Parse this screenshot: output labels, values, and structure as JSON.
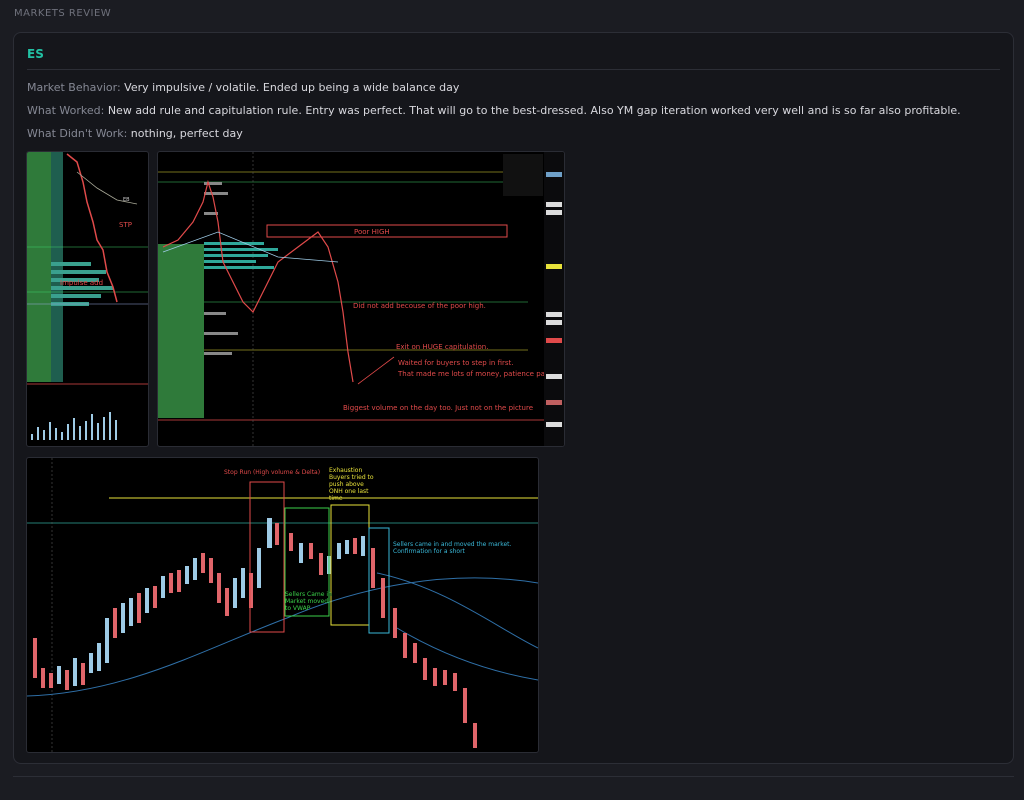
{
  "header": {
    "section_label": "MARKETS REVIEW"
  },
  "review": {
    "symbol": "ES",
    "market_behavior": {
      "label": "Market Behavior:",
      "text": "Very impulsive / volatile. Ended up being a wide balance day"
    },
    "what_worked": {
      "label": "What Worked:",
      "text": "New add rule and capitulation rule. Entry was perfect. That will go to the best-dressed. Also YM gap iteration worked very well and is so far also profitable."
    },
    "what_didnt_work": {
      "label": "What Didn't Work:",
      "text": "nothing, perfect day"
    }
  },
  "screenshots": {
    "small": {
      "label_stp": "STP",
      "label_impulse": "Impulse add",
      "label_eb": "EB"
    },
    "large": {
      "poor_high": "Poor HIGH",
      "did_not_add": "Did not add becouse of the poor high.",
      "exit": "Exit on HUGE capitulation.",
      "waited_1": "Waited for buyers to step in first.",
      "waited_2": "That made me lots of money, patience paid.",
      "biggest_volume": "Biggest volume on the day too. Just not on the picture"
    },
    "footprint": {
      "stop_run": "Stop Run (High volume & Delta)",
      "exhaustion_1": "Exhaustion",
      "exhaustion_2": "Buyers tried to",
      "exhaustion_3": "push above",
      "exhaustion_4": "ONH one last",
      "exhaustion_5": "time",
      "sellers_vwap_1": "Sellers Came in",
      "sellers_vwap_2": "Market moved",
      "sellers_vwap_3": "to VWAP",
      "sellers_short_1": "Sellers came in and moved the market.",
      "sellers_short_2": "Confirmation for a short"
    }
  },
  "colors": {
    "accent": "#22c1a4",
    "bull": "#9ecbe6",
    "bear": "#e0656a",
    "annotation_red": "#e04a4a",
    "yellow": "#e8e23a",
    "green_box": "#3bd14a",
    "cyan_box": "#3ab8d8"
  }
}
